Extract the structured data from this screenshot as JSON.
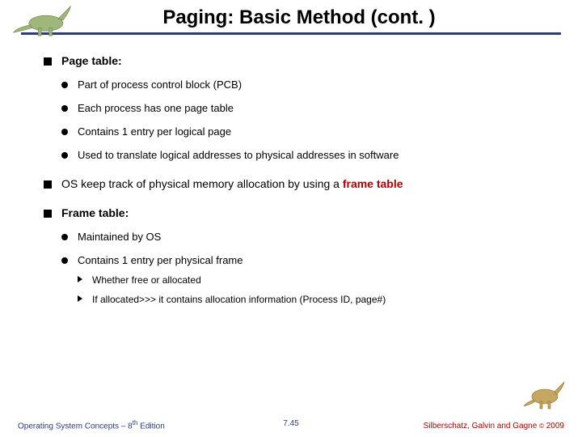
{
  "title": "Paging: Basic Method (cont. )",
  "bullets": {
    "b1": {
      "label": "Page table:",
      "items": [
        "Part of process control block (PCB)",
        "Each process has one page table",
        "Contains 1 entry per logical page",
        "Used to translate logical addresses to physical addresses in software"
      ]
    },
    "b2": {
      "prefix": "OS keep track of physical memory allocation by using a ",
      "highlight": "frame table"
    },
    "b3": {
      "label": "Frame table:",
      "items": {
        "i1": "Maintained by OS",
        "i2": {
          "label": "Contains 1 entry per physical frame",
          "sub": [
            "Whether free or allocated",
            "If allocated>>> it contains allocation information  (Process ID, page#)"
          ]
        }
      }
    }
  },
  "footer": {
    "left_prefix": "Operating System Concepts – 8",
    "left_sup": "th",
    "left_suffix": " Edition",
    "center": "7.45",
    "right_prefix": "Silberschatz, Galvin and Gagne ",
    "right_copy": "©",
    "right_year": " 2009"
  }
}
